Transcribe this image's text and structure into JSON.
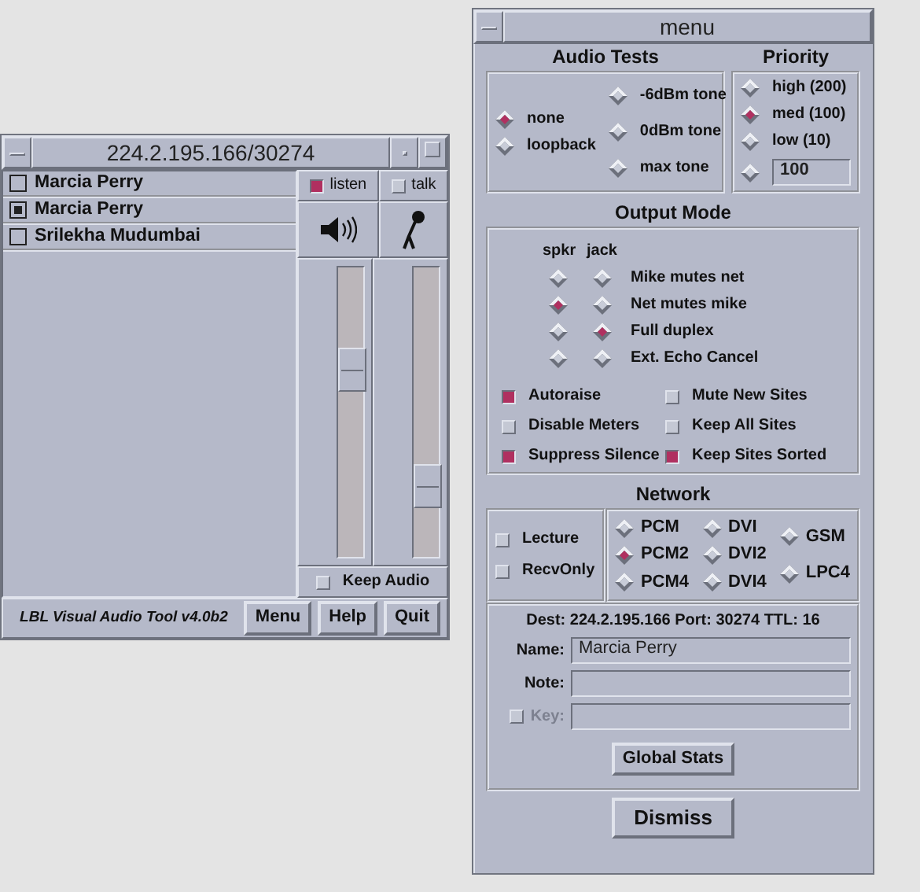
{
  "session_window": {
    "title": "224.2.195.166/30274",
    "sites": [
      {
        "name": "Marcia Perry",
        "selected": false
      },
      {
        "name": "Marcia Perry",
        "selected": true
      },
      {
        "name": "Srilekha Mudumbai",
        "selected": false
      }
    ],
    "listen": {
      "label": "listen",
      "checked": true
    },
    "talk": {
      "label": "talk",
      "checked": false
    },
    "speaker_volume": {
      "level": 0.67
    },
    "mic_gain": {
      "level": 0.2
    },
    "keep_audio": {
      "label": "Keep Audio",
      "checked": false
    },
    "version": "LBL Visual Audio Tool v4.0b2",
    "buttons": [
      "Menu",
      "Help",
      "Quit"
    ]
  },
  "menu_window": {
    "title": "menu",
    "audio_tests": {
      "heading": "Audio Tests",
      "columns": [
        [
          {
            "label": "none",
            "selected": true
          },
          {
            "label": "loopback",
            "selected": false
          }
        ],
        [
          {
            "label": "-6dBm tone",
            "selected": false
          },
          {
            "label": "0dBm tone",
            "selected": false
          },
          {
            "label": "max tone",
            "selected": false
          }
        ]
      ]
    },
    "priority": {
      "heading": "Priority",
      "options": [
        {
          "label": "high (200)",
          "selected": false
        },
        {
          "label": "med (100)",
          "selected": true
        },
        {
          "label": "low (10)",
          "selected": false
        }
      ],
      "custom": {
        "selected": false,
        "value": "100"
      }
    },
    "output_mode": {
      "heading": "Output Mode",
      "column_headers": [
        "spkr",
        "jack"
      ],
      "rows": [
        {
          "label": "Mike mutes net",
          "spkr": false,
          "jack": false
        },
        {
          "label": "Net mutes mike",
          "spkr": true,
          "jack": false
        },
        {
          "label": "Full duplex",
          "spkr": false,
          "jack": true
        },
        {
          "label": "Ext. Echo Cancel",
          "spkr": false,
          "jack": false
        }
      ],
      "options": [
        {
          "label": "Autoraise",
          "checked": true
        },
        {
          "label": "Mute New Sites",
          "checked": false
        },
        {
          "label": "Disable Meters",
          "checked": false
        },
        {
          "label": "Keep All Sites",
          "checked": false
        },
        {
          "label": "Suppress Silence",
          "checked": true
        },
        {
          "label": "Keep Sites Sorted",
          "checked": true
        }
      ]
    },
    "network": {
      "heading": "Network",
      "toggles": [
        {
          "label": "Lecture",
          "checked": false
        },
        {
          "label": "RecvOnly",
          "checked": false
        }
      ],
      "encoding_columns": [
        [
          {
            "label": "PCM",
            "selected": false
          },
          {
            "label": "PCM2",
            "selected": true
          },
          {
            "label": "PCM4",
            "selected": false
          }
        ],
        [
          {
            "label": "DVI",
            "selected": false
          },
          {
            "label": "DVI2",
            "selected": false
          },
          {
            "label": "DVI4",
            "selected": false
          }
        ],
        [
          {
            "label": "GSM",
            "selected": false
          },
          {
            "label": "LPC4",
            "selected": false
          }
        ]
      ]
    },
    "session": {
      "dest": "Dest: 224.2.195.166  Port: 30274  TTL: 16",
      "fields": [
        {
          "kind": "text",
          "label": "Name:",
          "value": "Marcia Perry"
        },
        {
          "kind": "text",
          "label": "Note:"
        },
        {
          "kind": "check",
          "label": "Key:",
          "checked": false,
          "disabled": true
        }
      ],
      "global_stats": "Global Stats"
    },
    "dismiss": "Dismiss"
  }
}
